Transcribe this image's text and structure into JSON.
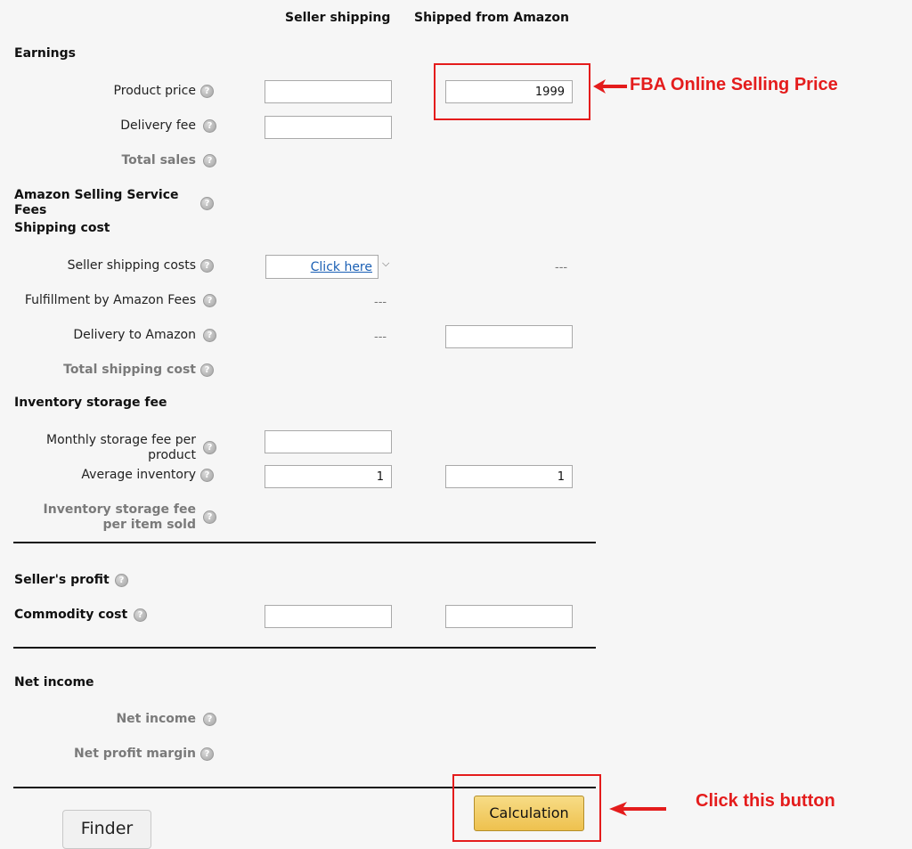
{
  "columns": {
    "seller": "Seller shipping",
    "amazon": "Shipped from Amazon"
  },
  "sections": {
    "earnings": "Earnings",
    "fees_line1": "Amazon Selling Service",
    "fees_line2": "Fees",
    "shipping_cost": "Shipping cost",
    "storage": "Inventory storage fee",
    "profit": "Seller's profit",
    "commodity": "Commodity cost",
    "net_income": "Net income"
  },
  "labels": {
    "product_price": "Product price",
    "delivery_fee": "Delivery fee",
    "total_sales": "Total sales",
    "seller_shipping_costs": "Seller shipping costs",
    "fba_fees": "Fulfillment by Amazon Fees",
    "delivery_to_amazon": "Delivery to Amazon",
    "total_shipping_cost": "Total shipping cost",
    "monthly_storage_line1": "Monthly storage fee per",
    "monthly_storage_line2": "product",
    "average_inventory": "Average inventory",
    "storage_per_item_line1": "Inventory storage fee",
    "storage_per_item_line2": "per item sold",
    "net_income": "Net income",
    "net_profit_margin": "Net profit margin"
  },
  "inputs": {
    "product_price_seller": "",
    "product_price_amazon": "1999",
    "delivery_fee_seller": "",
    "delivery_to_amazon_amazon": "",
    "monthly_storage_seller": "",
    "avg_inventory_seller": "1",
    "avg_inventory_amazon": "1",
    "commodity_seller": "",
    "commodity_amazon": ""
  },
  "values": {
    "seller_shipping_amazon": "---",
    "fba_fees_seller": "---",
    "delivery_to_amazon_seller": "---"
  },
  "links": {
    "click_here": "Click here"
  },
  "buttons": {
    "calculation": "Calculation",
    "finder": "Finder"
  },
  "annotations": {
    "fba_price": "FBA Online Selling Price",
    "click_button": "Click this button",
    "color": "#e41c1c"
  },
  "icons": {
    "help": "question-circle-icon",
    "dropdown": "chevron-down-icon",
    "arrow": "arrow-left-icon"
  }
}
